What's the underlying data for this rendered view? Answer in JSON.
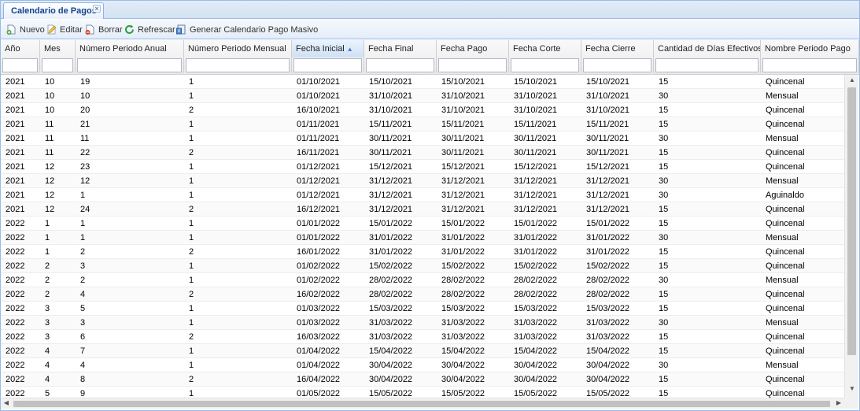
{
  "tab": {
    "title": "Calendario de Pagos",
    "close_glyph": "×"
  },
  "toolbar": {
    "nuevo": "Nuevo",
    "editar": "Editar",
    "borrar": "Borrar",
    "refrescar": "Refrescar",
    "generar": "Generar Calendario Pago Masivo"
  },
  "icons": {
    "nuevo": "add-icon",
    "editar": "edit-icon",
    "borrar": "delete-icon",
    "refrescar": "refresh-icon",
    "generar": "calendar-generate-icon"
  },
  "colors": {
    "accent": "#15428b",
    "border": "#99bbe8",
    "refresh": "#2e9e3a"
  },
  "grid": {
    "columns": [
      "Año",
      "Mes",
      "Número Periodo Anual",
      "Número Periodo Mensual",
      "Fecha Inicial",
      "Fecha Final",
      "Fecha Pago",
      "Fecha Corte",
      "Fecha Cierre",
      "Cantidad de Días Efectivos",
      "Nombre Periodo Pago"
    ],
    "sort_glyph": "▲",
    "rows": [
      [
        "2021",
        "10",
        "19",
        "1",
        "01/10/2021",
        "15/10/2021",
        "15/10/2021",
        "15/10/2021",
        "15/10/2021",
        "15",
        "Quincenal"
      ],
      [
        "2021",
        "10",
        "10",
        "1",
        "01/10/2021",
        "31/10/2021",
        "31/10/2021",
        "31/10/2021",
        "31/10/2021",
        "30",
        "Mensual"
      ],
      [
        "2021",
        "10",
        "20",
        "2",
        "16/10/2021",
        "31/10/2021",
        "31/10/2021",
        "31/10/2021",
        "31/10/2021",
        "15",
        "Quincenal"
      ],
      [
        "2021",
        "11",
        "21",
        "1",
        "01/11/2021",
        "15/11/2021",
        "15/11/2021",
        "15/11/2021",
        "15/11/2021",
        "15",
        "Quincenal"
      ],
      [
        "2021",
        "11",
        "11",
        "1",
        "01/11/2021",
        "30/11/2021",
        "30/11/2021",
        "30/11/2021",
        "30/11/2021",
        "30",
        "Mensual"
      ],
      [
        "2021",
        "11",
        "22",
        "2",
        "16/11/2021",
        "30/11/2021",
        "30/11/2021",
        "30/11/2021",
        "30/11/2021",
        "15",
        "Quincenal"
      ],
      [
        "2021",
        "12",
        "23",
        "1",
        "01/12/2021",
        "15/12/2021",
        "15/12/2021",
        "15/12/2021",
        "15/12/2021",
        "15",
        "Quincenal"
      ],
      [
        "2021",
        "12",
        "12",
        "1",
        "01/12/2021",
        "31/12/2021",
        "31/12/2021",
        "31/12/2021",
        "31/12/2021",
        "30",
        "Mensual"
      ],
      [
        "2021",
        "12",
        "1",
        "1",
        "01/12/2021",
        "31/12/2021",
        "31/12/2021",
        "31/12/2021",
        "31/12/2021",
        "30",
        "Aguinaldo"
      ],
      [
        "2021",
        "12",
        "24",
        "2",
        "16/12/2021",
        "31/12/2021",
        "31/12/2021",
        "31/12/2021",
        "31/12/2021",
        "15",
        "Quincenal"
      ],
      [
        "2022",
        "1",
        "1",
        "1",
        "01/01/2022",
        "15/01/2022",
        "15/01/2022",
        "15/01/2022",
        "15/01/2022",
        "15",
        "Quincenal"
      ],
      [
        "2022",
        "1",
        "1",
        "1",
        "01/01/2022",
        "31/01/2022",
        "31/01/2022",
        "31/01/2022",
        "31/01/2022",
        "30",
        "Mensual"
      ],
      [
        "2022",
        "1",
        "2",
        "2",
        "16/01/2022",
        "31/01/2022",
        "31/01/2022",
        "31/01/2022",
        "31/01/2022",
        "15",
        "Quincenal"
      ],
      [
        "2022",
        "2",
        "3",
        "1",
        "01/02/2022",
        "15/02/2022",
        "15/02/2022",
        "15/02/2022",
        "15/02/2022",
        "15",
        "Quincenal"
      ],
      [
        "2022",
        "2",
        "2",
        "1",
        "01/02/2022",
        "28/02/2022",
        "28/02/2022",
        "28/02/2022",
        "28/02/2022",
        "30",
        "Mensual"
      ],
      [
        "2022",
        "2",
        "4",
        "2",
        "16/02/2022",
        "28/02/2022",
        "28/02/2022",
        "28/02/2022",
        "28/02/2022",
        "15",
        "Quincenal"
      ],
      [
        "2022",
        "3",
        "5",
        "1",
        "01/03/2022",
        "15/03/2022",
        "15/03/2022",
        "15/03/2022",
        "15/03/2022",
        "15",
        "Quincenal"
      ],
      [
        "2022",
        "3",
        "3",
        "1",
        "01/03/2022",
        "31/03/2022",
        "31/03/2022",
        "31/03/2022",
        "31/03/2022",
        "30",
        "Mensual"
      ],
      [
        "2022",
        "3",
        "6",
        "2",
        "16/03/2022",
        "31/03/2022",
        "31/03/2022",
        "31/03/2022",
        "31/03/2022",
        "15",
        "Quincenal"
      ],
      [
        "2022",
        "4",
        "7",
        "1",
        "01/04/2022",
        "15/04/2022",
        "15/04/2022",
        "15/04/2022",
        "15/04/2022",
        "15",
        "Quincenal"
      ],
      [
        "2022",
        "4",
        "4",
        "1",
        "01/04/2022",
        "30/04/2022",
        "30/04/2022",
        "30/04/2022",
        "30/04/2022",
        "30",
        "Mensual"
      ],
      [
        "2022",
        "4",
        "8",
        "2",
        "16/04/2022",
        "30/04/2022",
        "30/04/2022",
        "30/04/2022",
        "30/04/2022",
        "15",
        "Quincenal"
      ],
      [
        "2022",
        "5",
        "9",
        "1",
        "01/05/2022",
        "15/05/2022",
        "15/05/2022",
        "15/05/2022",
        "15/05/2022",
        "15",
        "Quincenal"
      ]
    ]
  }
}
